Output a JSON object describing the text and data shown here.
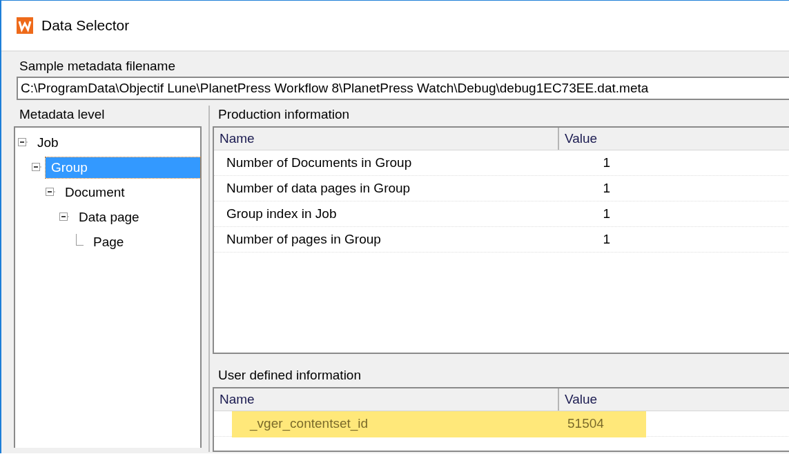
{
  "window": {
    "title": "Data Selector"
  },
  "filename": {
    "label": "Sample metadata filename",
    "value": "C:\\ProgramData\\Objectif Lune\\PlanetPress Workflow 8\\PlanetPress Watch\\Debug\\debug1EC73EE.dat.meta"
  },
  "metadata_level": {
    "label": "Metadata level",
    "tree": [
      {
        "label": "Job",
        "expanded": true,
        "selected": false,
        "children": [
          {
            "label": "Group",
            "expanded": true,
            "selected": true,
            "children": [
              {
                "label": "Document",
                "expanded": true,
                "selected": false,
                "children": [
                  {
                    "label": "Data page",
                    "expanded": true,
                    "selected": false,
                    "children": [
                      {
                        "label": "Page",
                        "selected": false
                      }
                    ]
                  }
                ]
              }
            ]
          }
        ]
      }
    ]
  },
  "production_information": {
    "label": "Production information",
    "columns": [
      "Name",
      "Value"
    ],
    "rows": [
      {
        "name": "Number of Documents in Group",
        "value": "1"
      },
      {
        "name": "Number of data pages in Group",
        "value": "1"
      },
      {
        "name": "Group index in Job",
        "value": "1"
      },
      {
        "name": "Number of pages in Group",
        "value": "1"
      }
    ]
  },
  "user_defined_information": {
    "label": "User defined information",
    "columns": [
      "Name",
      "Value"
    ],
    "rows": [
      {
        "name": "_vger_contentset_id",
        "value": "51504",
        "highlighted": true
      }
    ]
  }
}
